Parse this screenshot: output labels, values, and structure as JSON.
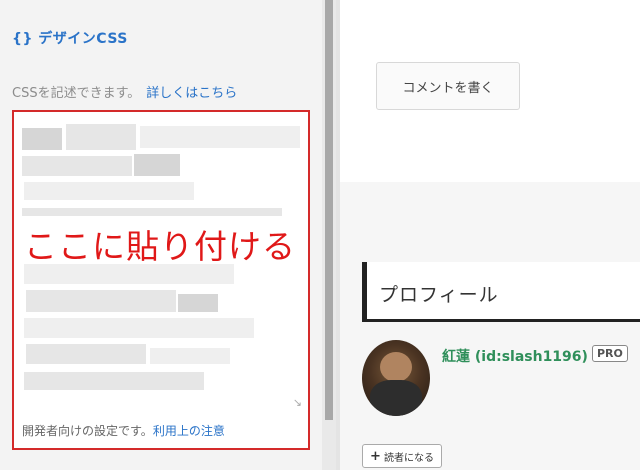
{
  "left_panel": {
    "title": "{} デザインCSS",
    "description": "CSSを記述できます。",
    "description_link": "詳しくはこちら",
    "paste_label": "ここに貼り付ける",
    "footnote": "開発者向けの設定です。",
    "footnote_link": "利用上の注意",
    "resize_icon": "resize-handle-icon"
  },
  "main": {
    "comment_button": "コメントを書く",
    "profile_heading": "プロフィール",
    "profile_name": "紅蓮 (id:slash1196)",
    "pro_badge": "PRO",
    "reader_button": "読者になる"
  },
  "colors": {
    "accent_blue": "#2a73c8",
    "highlight_red": "#d42a2a",
    "profile_green": "#2f8f5a"
  }
}
